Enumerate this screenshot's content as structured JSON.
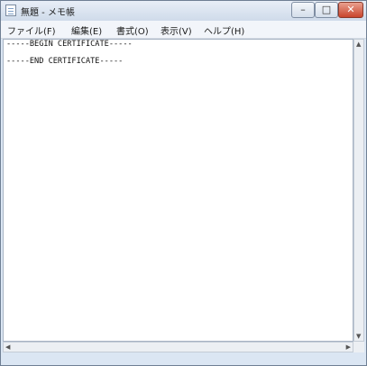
{
  "window": {
    "title": "無題 - メモ帳"
  },
  "title_buttons": {
    "minimize": "–",
    "maximize": "□",
    "close": "✕"
  },
  "menu": [
    {
      "label": "ファイル(F)"
    },
    {
      "label": "編集(E)"
    },
    {
      "label": "書式(O)"
    },
    {
      "label": "表示(V)"
    },
    {
      "label": "ヘルプ(H)"
    }
  ],
  "editor": {
    "begin_line": "-----BEGIN CERTIFICATE-----",
    "body": "",
    "end_line": "-----END CERTIFICATE-----"
  },
  "scrollbars": {
    "up": "▲",
    "down": "▼",
    "left": "◀",
    "right": "▶"
  },
  "icons": {
    "app": "notepad-icon"
  }
}
